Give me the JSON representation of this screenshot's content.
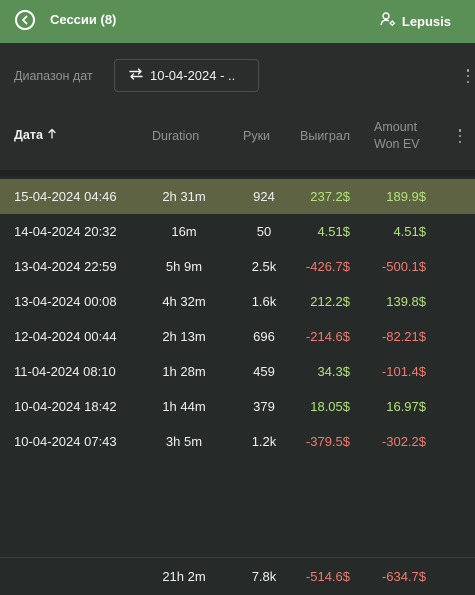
{
  "colors": {
    "header_bg": "#5a8f55",
    "panel_bg": "#262a29",
    "selected_row": "#5e6443",
    "positive": "#b4e27a",
    "negative": "#f07b6f"
  },
  "header": {
    "back_icon": "back-arrow-circle-icon",
    "title": "Сессии (8)",
    "user_icon": "user-settings-icon",
    "user_name": "Lepusis"
  },
  "toolbar": {
    "range_label": "Диапазон дат",
    "swap_icon": "swap-arrows-icon",
    "date_range": "10-04-2024 - .."
  },
  "columns": {
    "date": "Дата",
    "date_sort_icon": "sort-up-arrow-icon",
    "duration": "Duration",
    "hands": "Руки",
    "won": "Выиграл",
    "won_ev_line1": "Amount",
    "won_ev_line2": "Won EV"
  },
  "sessions": [
    {
      "date": "15-04-2024 04:46",
      "duration": "2h 31m",
      "hands": "924",
      "won": "237.2$",
      "won_sign": "pos",
      "ev": "189.9$",
      "ev_sign": "pos",
      "selected": true
    },
    {
      "date": "14-04-2024 20:32",
      "duration": "16m",
      "hands": "50",
      "won": "4.51$",
      "won_sign": "pos",
      "ev": "4.51$",
      "ev_sign": "pos",
      "selected": false
    },
    {
      "date": "13-04-2024 22:59",
      "duration": "5h 9m",
      "hands": "2.5k",
      "won": "-426.7$",
      "won_sign": "neg",
      "ev": "-500.1$",
      "ev_sign": "neg",
      "selected": false
    },
    {
      "date": "13-04-2024 00:08",
      "duration": "4h 32m",
      "hands": "1.6k",
      "won": "212.2$",
      "won_sign": "pos",
      "ev": "139.8$",
      "ev_sign": "pos",
      "selected": false
    },
    {
      "date": "12-04-2024 00:44",
      "duration": "2h 13m",
      "hands": "696",
      "won": "-214.6$",
      "won_sign": "neg",
      "ev": "-82.21$",
      "ev_sign": "neg",
      "selected": false
    },
    {
      "date": "11-04-2024 08:10",
      "duration": "1h 28m",
      "hands": "459",
      "won": "34.3$",
      "won_sign": "pos",
      "ev": "-101.4$",
      "ev_sign": "neg",
      "selected": false
    },
    {
      "date": "10-04-2024 18:42",
      "duration": "1h 44m",
      "hands": "379",
      "won": "18.05$",
      "won_sign": "pos",
      "ev": "16.97$",
      "ev_sign": "pos",
      "selected": false
    },
    {
      "date": "10-04-2024 07:43",
      "duration": "3h 5m",
      "hands": "1.2k",
      "won": "-379.5$",
      "won_sign": "neg",
      "ev": "-302.2$",
      "ev_sign": "neg",
      "selected": false
    }
  ],
  "totals": {
    "duration": "21h 2m",
    "hands": "7.8k",
    "won": "-514.6$",
    "won_sign": "neg",
    "ev": "-634.7$",
    "ev_sign": "neg"
  }
}
